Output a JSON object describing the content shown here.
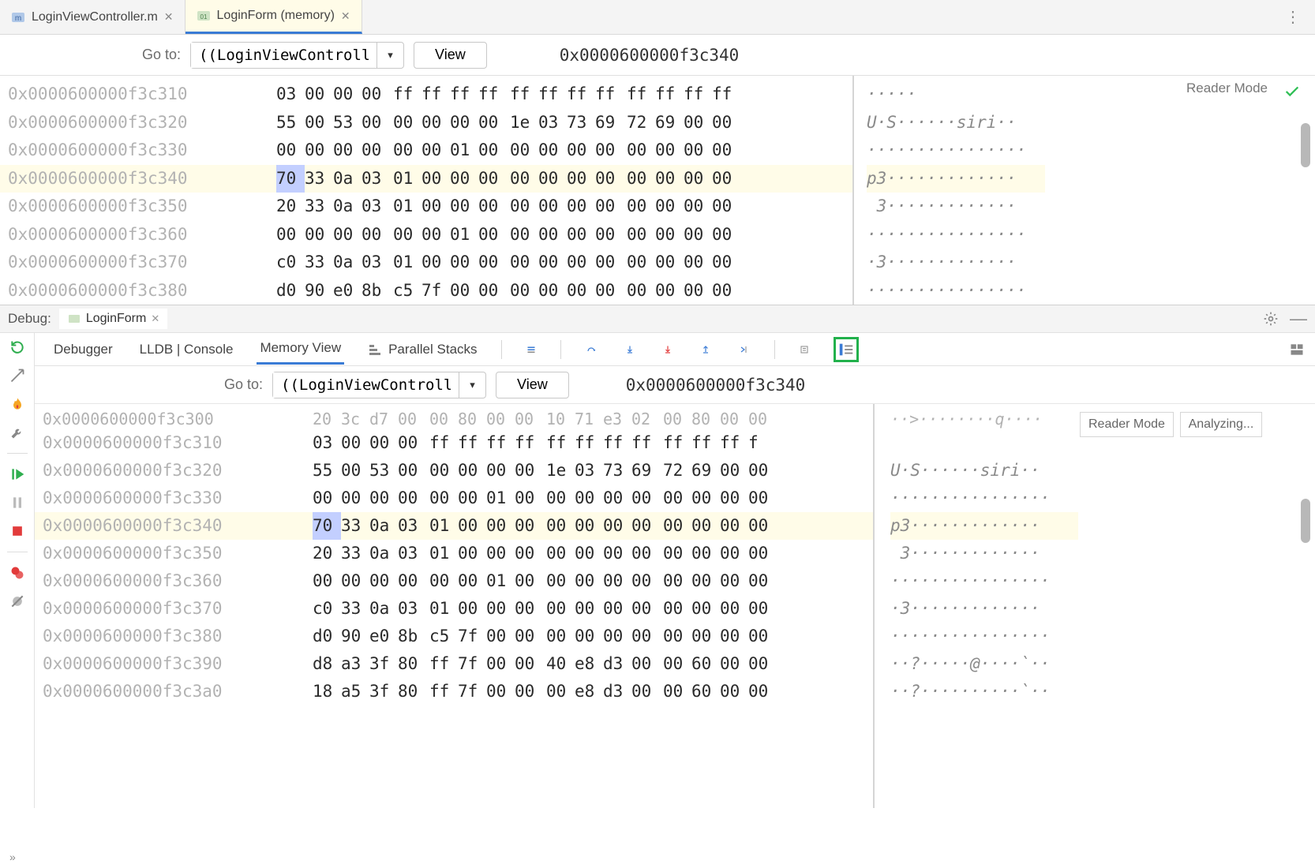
{
  "editor": {
    "tabs": [
      {
        "label": "LoginViewController.m",
        "active": false
      },
      {
        "label": "LoginForm (memory)",
        "active": true
      }
    ]
  },
  "top_goto": {
    "label": "Go to:",
    "input": "((LoginViewControll",
    "button": "View",
    "address": "0x0000600000f3c340"
  },
  "top_mem": {
    "reader_mode": "Reader Mode",
    "highlight_index": 3,
    "rows": [
      {
        "addr": "0x0000600000f3c310",
        "hex": [
          [
            "03",
            "00",
            "00",
            "00"
          ],
          [
            "ff",
            "ff",
            "ff",
            "ff"
          ],
          [
            "ff",
            "ff",
            "ff",
            "ff"
          ],
          [
            "ff",
            "ff",
            "ff",
            "ff"
          ]
        ],
        "ascii": "·····"
      },
      {
        "addr": "0x0000600000f3c320",
        "hex": [
          [
            "55",
            "00",
            "53",
            "00"
          ],
          [
            "00",
            "00",
            "00",
            "00"
          ],
          [
            "1e",
            "03",
            "73",
            "69"
          ],
          [
            "72",
            "69",
            "00",
            "00"
          ]
        ],
        "ascii": "U·S······siri··"
      },
      {
        "addr": "0x0000600000f3c330",
        "hex": [
          [
            "00",
            "00",
            "00",
            "00"
          ],
          [
            "00",
            "00",
            "01",
            "00"
          ],
          [
            "00",
            "00",
            "00",
            "00"
          ],
          [
            "00",
            "00",
            "00",
            "00"
          ]
        ],
        "ascii": "················"
      },
      {
        "addr": "0x0000600000f3c340",
        "hex": [
          [
            "70",
            "33",
            "0a",
            "03"
          ],
          [
            "01",
            "00",
            "00",
            "00"
          ],
          [
            "00",
            "00",
            "00",
            "00"
          ],
          [
            "00",
            "00",
            "00",
            "00"
          ]
        ],
        "ascii": "p3·············"
      },
      {
        "addr": "0x0000600000f3c350",
        "hex": [
          [
            "20",
            "33",
            "0a",
            "03"
          ],
          [
            "01",
            "00",
            "00",
            "00"
          ],
          [
            "00",
            "00",
            "00",
            "00"
          ],
          [
            "00",
            "00",
            "00",
            "00"
          ]
        ],
        "ascii": " 3·············"
      },
      {
        "addr": "0x0000600000f3c360",
        "hex": [
          [
            "00",
            "00",
            "00",
            "00"
          ],
          [
            "00",
            "00",
            "01",
            "00"
          ],
          [
            "00",
            "00",
            "00",
            "00"
          ],
          [
            "00",
            "00",
            "00",
            "00"
          ]
        ],
        "ascii": "················"
      },
      {
        "addr": "0x0000600000f3c370",
        "hex": [
          [
            "c0",
            "33",
            "0a",
            "03"
          ],
          [
            "01",
            "00",
            "00",
            "00"
          ],
          [
            "00",
            "00",
            "00",
            "00"
          ],
          [
            "00",
            "00",
            "00",
            "00"
          ]
        ],
        "ascii": "·3·············"
      },
      {
        "addr": "0x0000600000f3c380",
        "hex": [
          [
            "d0",
            "90",
            "e0",
            "8b"
          ],
          [
            "c5",
            "7f",
            "00",
            "00"
          ],
          [
            "00",
            "00",
            "00",
            "00"
          ],
          [
            "00",
            "00",
            "00",
            "00"
          ]
        ],
        "ascii": "················"
      }
    ]
  },
  "debug_header": {
    "title": "Debug:",
    "run_config": "LoginForm"
  },
  "debug_tabs": {
    "items": [
      "Debugger",
      "LLDB | Console",
      "Memory View",
      "Parallel Stacks"
    ],
    "active": 2
  },
  "debug_goto": {
    "label": "Go to:",
    "input": "((LoginViewControll",
    "button": "View",
    "address": "0x0000600000f3c340"
  },
  "debug_mem": {
    "reader_mode": "Reader Mode",
    "analyzing": "Analyzing...",
    "partial_top": {
      "addr": "0x0000600000f3c300",
      "hex": [
        [
          "20",
          "3c",
          "d7",
          "00"
        ],
        [
          "00",
          "80",
          "00",
          "00"
        ],
        [
          "10",
          "71",
          "e3",
          "02"
        ],
        [
          "00",
          "80",
          "00",
          "00"
        ]
      ],
      "ascii": "··>········q····"
    },
    "highlight_index": 3,
    "rows": [
      {
        "addr": "0x0000600000f3c310",
        "hex": [
          [
            "03",
            "00",
            "00",
            "00"
          ],
          [
            "ff",
            "ff",
            "ff",
            "ff"
          ],
          [
            "ff",
            "ff",
            "ff",
            "ff"
          ],
          [
            "ff",
            "ff",
            "ff",
            "f"
          ]
        ],
        "ascii": ""
      },
      {
        "addr": "0x0000600000f3c320",
        "hex": [
          [
            "55",
            "00",
            "53",
            "00"
          ],
          [
            "00",
            "00",
            "00",
            "00"
          ],
          [
            "1e",
            "03",
            "73",
            "69"
          ],
          [
            "72",
            "69",
            "00",
            "00"
          ]
        ],
        "ascii": "U·S······siri··"
      },
      {
        "addr": "0x0000600000f3c330",
        "hex": [
          [
            "00",
            "00",
            "00",
            "00"
          ],
          [
            "00",
            "00",
            "01",
            "00"
          ],
          [
            "00",
            "00",
            "00",
            "00"
          ],
          [
            "00",
            "00",
            "00",
            "00"
          ]
        ],
        "ascii": "················"
      },
      {
        "addr": "0x0000600000f3c340",
        "hex": [
          [
            "70",
            "33",
            "0a",
            "03"
          ],
          [
            "01",
            "00",
            "00",
            "00"
          ],
          [
            "00",
            "00",
            "00",
            "00"
          ],
          [
            "00",
            "00",
            "00",
            "00"
          ]
        ],
        "ascii": "p3·············"
      },
      {
        "addr": "0x0000600000f3c350",
        "hex": [
          [
            "20",
            "33",
            "0a",
            "03"
          ],
          [
            "01",
            "00",
            "00",
            "00"
          ],
          [
            "00",
            "00",
            "00",
            "00"
          ],
          [
            "00",
            "00",
            "00",
            "00"
          ]
        ],
        "ascii": " 3·············"
      },
      {
        "addr": "0x0000600000f3c360",
        "hex": [
          [
            "00",
            "00",
            "00",
            "00"
          ],
          [
            "00",
            "00",
            "01",
            "00"
          ],
          [
            "00",
            "00",
            "00",
            "00"
          ],
          [
            "00",
            "00",
            "00",
            "00"
          ]
        ],
        "ascii": "················"
      },
      {
        "addr": "0x0000600000f3c370",
        "hex": [
          [
            "c0",
            "33",
            "0a",
            "03"
          ],
          [
            "01",
            "00",
            "00",
            "00"
          ],
          [
            "00",
            "00",
            "00",
            "00"
          ],
          [
            "00",
            "00",
            "00",
            "00"
          ]
        ],
        "ascii": "·3·············"
      },
      {
        "addr": "0x0000600000f3c380",
        "hex": [
          [
            "d0",
            "90",
            "e0",
            "8b"
          ],
          [
            "c5",
            "7f",
            "00",
            "00"
          ],
          [
            "00",
            "00",
            "00",
            "00"
          ],
          [
            "00",
            "00",
            "00",
            "00"
          ]
        ],
        "ascii": "················"
      },
      {
        "addr": "0x0000600000f3c390",
        "hex": [
          [
            "d8",
            "a3",
            "3f",
            "80"
          ],
          [
            "ff",
            "7f",
            "00",
            "00"
          ],
          [
            "40",
            "e8",
            "d3",
            "00"
          ],
          [
            "00",
            "60",
            "00",
            "00"
          ]
        ],
        "ascii": "··?·····@····`··"
      },
      {
        "addr": "0x0000600000f3c3a0",
        "hex": [
          [
            "18",
            "a5",
            "3f",
            "80"
          ],
          [
            "ff",
            "7f",
            "00",
            "00"
          ],
          [
            "00",
            "e8",
            "d3",
            "00"
          ],
          [
            "00",
            "60",
            "00",
            "00"
          ]
        ],
        "ascii": "··?··········`··"
      }
    ]
  }
}
